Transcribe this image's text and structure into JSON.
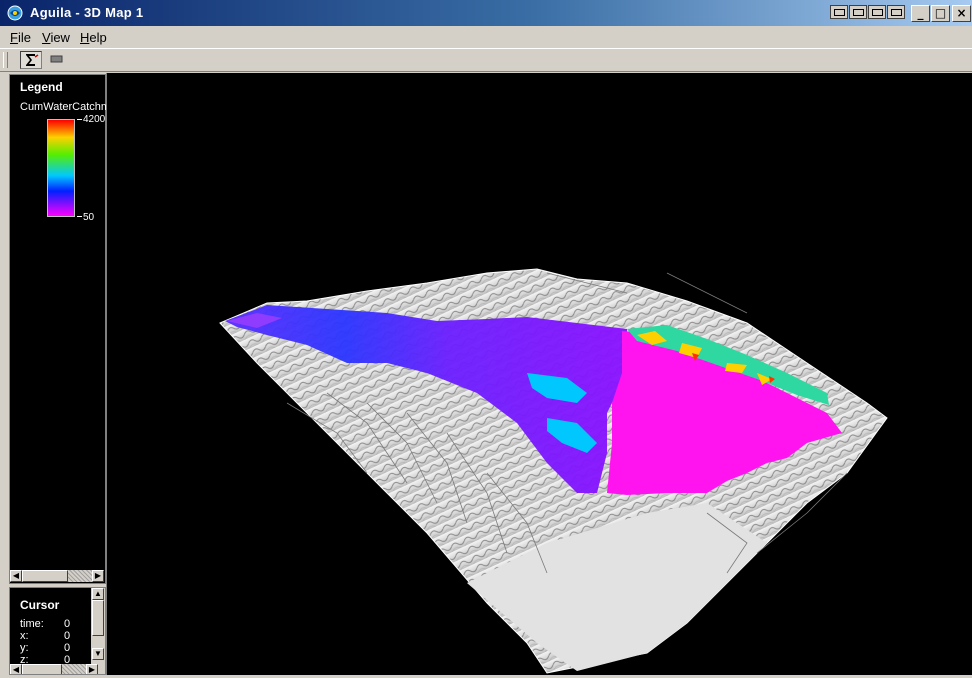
{
  "window": {
    "title": "Aguila - 3D Map 1",
    "controls": {
      "minimize": "_",
      "maximize": "□",
      "close": "×"
    }
  },
  "menu": [
    {
      "accel": "F",
      "rest": "ile"
    },
    {
      "accel": "V",
      "rest": "iew"
    },
    {
      "accel": "H",
      "rest": "elp"
    }
  ],
  "toolbar": {
    "icons": [
      "sigma-icon",
      "stop-icon"
    ]
  },
  "legend": {
    "title": "Legend",
    "attribute": "CumWaterCatchment",
    "max": "4200",
    "min": "50",
    "colors": [
      "#ff0000",
      "#ffd000",
      "#55ee00",
      "#00c8ff",
      "#0020ff",
      "#ff00ff"
    ]
  },
  "cursor": {
    "title": "Cursor",
    "rows": [
      {
        "label": "time:",
        "value": "0"
      },
      {
        "label": "x:",
        "value": "0"
      },
      {
        "label": "y:",
        "value": "0"
      },
      {
        "label": "z:",
        "value": "0"
      }
    ]
  },
  "map": {
    "background": "#000000",
    "terrain_color": "#e8e8e8"
  }
}
